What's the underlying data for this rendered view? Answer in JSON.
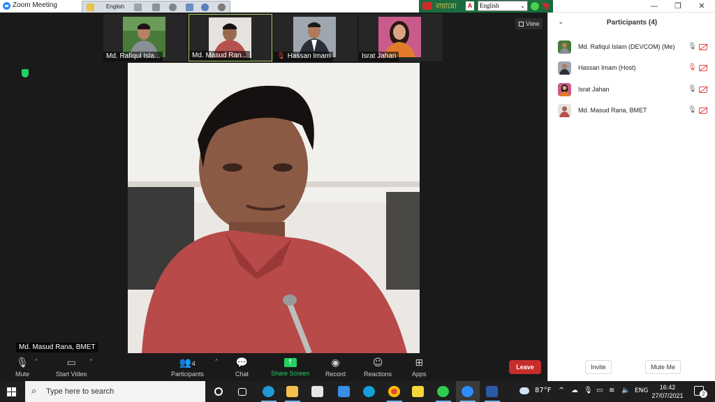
{
  "window": {
    "title": "Zoom Meeting",
    "controls": {
      "minimize": "—",
      "restore": "❐",
      "close": "✕"
    }
  },
  "language_toolbar": {
    "language": "English"
  },
  "ime_bar": {
    "label": "বায়ান্নো",
    "selected_language": "English"
  },
  "thumbnails": [
    {
      "name": "Md. Rafiqul Isla...",
      "muted": false,
      "active": false
    },
    {
      "name": "Md. Masud Ran...",
      "muted": false,
      "active": true
    },
    {
      "name": "Hassan Imam",
      "muted": true,
      "active": false
    },
    {
      "name": "Israt Jahan",
      "muted": false,
      "active": false
    }
  ],
  "view_button": {
    "label": "View"
  },
  "active_speaker": {
    "name": "Md. Masud Rana, BMET"
  },
  "toolbar": {
    "mute": "Mute",
    "start_video": "Start Video",
    "participants": "Participants",
    "participants_count": "4",
    "chat": "Chat",
    "share_screen": "Share Screen",
    "record": "Record",
    "reactions": "Reactions",
    "apps": "Apps",
    "leave": "Leave"
  },
  "participants_panel": {
    "title": "Participants (4)",
    "participants": [
      {
        "name": "Md. Rafiqul Islam (DEVCOM) (Me)",
        "mic_muted": false
      },
      {
        "name": "Hassan Imam (Host)",
        "mic_muted": true
      },
      {
        "name": "Israt Jahan",
        "mic_muted": false
      },
      {
        "name": "Md. Masud Rana, BMET",
        "mic_muted": false
      }
    ],
    "invite": "Invite",
    "mute_me": "Mute Me"
  },
  "taskbar": {
    "search_placeholder": "Type here to search",
    "weather": "87°F",
    "language": "ENG",
    "time": "16:42",
    "date": "27/07/2021",
    "notifications": "2"
  },
  "colors": {
    "zoom_blue": "#2d8cff",
    "share_green": "#23d160",
    "leave_red": "#c72d2d",
    "muted_red": "#e54545",
    "active_border": "#a7d45e"
  }
}
